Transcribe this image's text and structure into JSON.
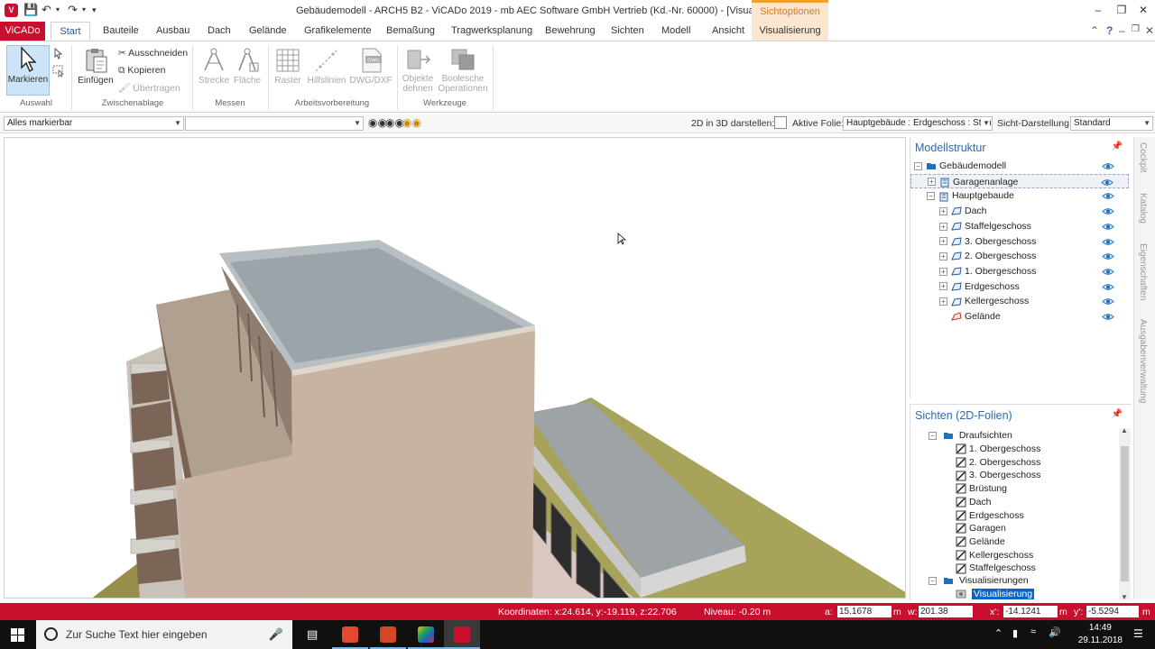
{
  "titlebar": {
    "title": "Gebäudemodell - ARCH5 B2 - ViCADo 2019 - mb AEC Software GmbH Vertrieb (Kd.-Nr. 60000) - [Visualisierung]",
    "context_tab": "Sichtoptionen"
  },
  "tabs": {
    "app_menu": "ViCADo",
    "items": [
      "Start",
      "Bauteile",
      "Ausbau",
      "Dach",
      "Gelände",
      "Grafikelemente",
      "Bemaßung",
      "Tragwerksplanung",
      "Bewehrung",
      "Sichten",
      "Modell",
      "Ansicht"
    ],
    "context": "Visualisierung"
  },
  "ribbon": {
    "auswahl": {
      "markieren": "Markieren",
      "group": "Auswahl"
    },
    "zwischenablage": {
      "einfuegen": "Einfügen",
      "ausschneiden": "Ausschneiden",
      "kopieren": "Kopieren",
      "uebertragen": "Übertragen",
      "group": "Zwischenablage"
    },
    "messen": {
      "strecke": "Strecke",
      "flaeche": "Fläche",
      "group": "Messen"
    },
    "arbeitsvorbereitung": {
      "raster": "Raster",
      "hilfslinien": "Hilfslinien",
      "dwg": "DWG/DXF",
      "group": "Arbeitsvorbereitung"
    },
    "werkzeuge": {
      "objekte_line1": "Objekte",
      "objekte_line2": "dehnen",
      "boolesche_line1": "Boolesche",
      "boolesche_line2": "Operationen",
      "group": "Werkzeuge"
    }
  },
  "toolbar": {
    "filter_value": "Alles markierbar",
    "second_value": "",
    "label_2d3d": "2D in 3D darstellen:",
    "label_folie": "Aktive Folie:",
    "folie_value": "Hauptgebäude : Erdgeschoss : Standard",
    "label_sicht": "Sicht-Darstellung:",
    "sicht_value": "Standard"
  },
  "model_panel": {
    "title": "Modellstruktur",
    "items": [
      {
        "label": "Gebäudemodell",
        "level": 0,
        "exp": "−",
        "icon": "folder"
      },
      {
        "label": "Garagenanlage",
        "level": 1,
        "exp": "+",
        "icon": "building"
      },
      {
        "label": "Hauptgebaude",
        "level": 1,
        "exp": "−",
        "icon": "building"
      },
      {
        "label": "Dach",
        "level": 2,
        "exp": "+",
        "icon": "floor"
      },
      {
        "label": "Staffelgeschoss",
        "level": 2,
        "exp": "+",
        "icon": "floor"
      },
      {
        "label": "3. Obergeschoss",
        "level": 2,
        "exp": "+",
        "icon": "floor"
      },
      {
        "label": "2. Obergeschoss",
        "level": 2,
        "exp": "+",
        "icon": "floor"
      },
      {
        "label": "1. Obergeschoss",
        "level": 2,
        "exp": "+",
        "icon": "floor"
      },
      {
        "label": "Erdgeschoss",
        "level": 2,
        "exp": "+",
        "icon": "floor"
      },
      {
        "label": "Kellergeschoss",
        "level": 2,
        "exp": "+",
        "icon": "floor"
      },
      {
        "label": "Gelände",
        "level": 2,
        "exp": "",
        "icon": "terrain"
      }
    ]
  },
  "views_panel": {
    "title": "Sichten (2D-Folien)",
    "group1": "Draufsichten",
    "items": [
      "1. Obergeschoss",
      "2. Obergeschoss",
      "3. Obergeschoss",
      "Brüstung",
      "Dach",
      "Erdgeschoss",
      "Garagen",
      "Gelände",
      "Kellergeschoss",
      "Staffelgeschoss"
    ],
    "group2": "Visualisierungen",
    "selected": "Visualisierung"
  },
  "side_tabs": [
    "Cockpit",
    "Katalog",
    "Eigenschaften",
    "Ausgabenverwaltung"
  ],
  "statusbar": {
    "coords": "Koordinaten: x:24.614, y:-19.119, z:22.706",
    "niveau": "Niveau: -0.20 m",
    "a_label": "a:",
    "a_value": "15.1678",
    "m_label": "m",
    "w_label": "w:",
    "w_value": "201.38",
    "x_label": "x':",
    "x_value": "-14.1241",
    "m2_label": "m",
    "y_label": "y':",
    "y_value": "-5.5294",
    "m3_label": "m"
  },
  "taskbar": {
    "search_placeholder": "Zur Suche Text hier eingeben",
    "time": "14:49",
    "date": "29.11.2018"
  },
  "colors": {
    "brand_red": "#c8102e",
    "context_orange": "#f0a030",
    "link_blue": "#2b6cb0"
  }
}
